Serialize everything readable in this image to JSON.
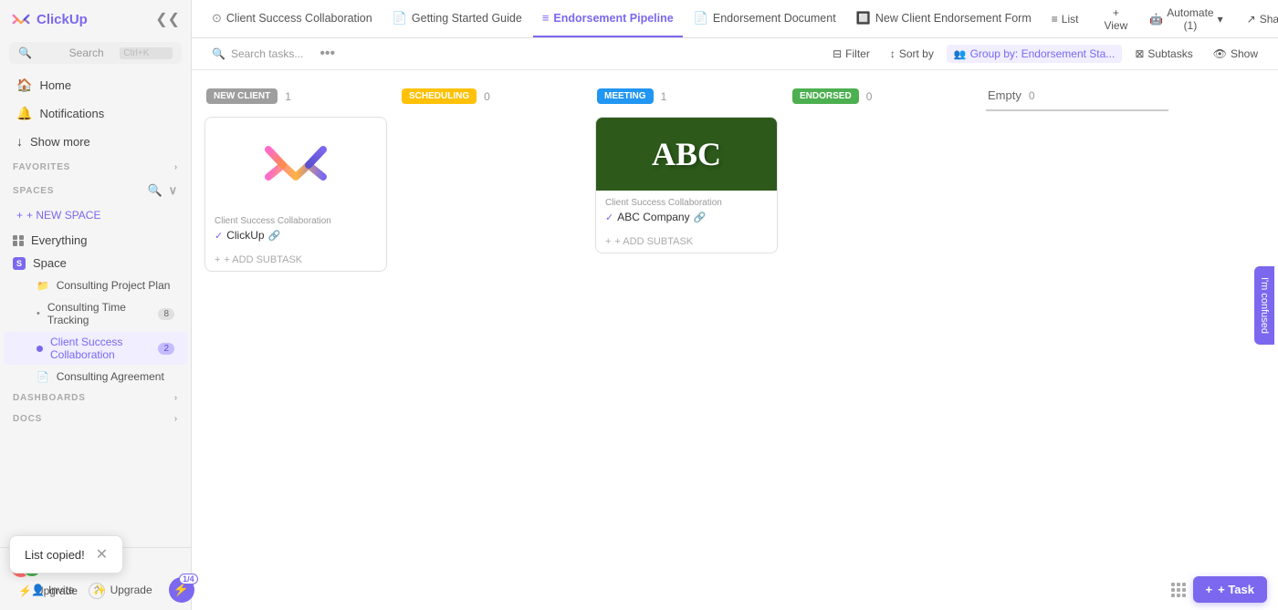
{
  "app": {
    "name": "ClickUp",
    "logo_text": "ClickUp"
  },
  "sidebar": {
    "search_placeholder": "Search",
    "search_shortcut": "Ctrl+K",
    "nav": [
      {
        "label": "Home",
        "icon": "🏠"
      },
      {
        "label": "Notifications",
        "icon": "🔔"
      },
      {
        "label": "Show more",
        "icon": "↓"
      }
    ],
    "sections": {
      "favorites": "FAVORITES",
      "spaces": "SPACES"
    },
    "new_space_label": "+ NEW SPACE",
    "everything_label": "Everything",
    "space_label": "Space",
    "space_badge": "S",
    "sub_items": [
      {
        "label": "Consulting Project Plan",
        "type": "folder",
        "count": null,
        "active": false
      },
      {
        "label": "Consulting Time Tracking",
        "type": "list",
        "count": "8",
        "active": false
      },
      {
        "label": "Client Success Collaboration",
        "type": "dot",
        "count": "2",
        "active": true
      },
      {
        "label": "Consulting Agreement",
        "type": "doc",
        "count": null,
        "active": false
      }
    ],
    "dashboards_label": "DASHBOARDS",
    "docs_label": "DOCS",
    "invite_label": "Invite",
    "upgrade_label": "Upgrade"
  },
  "top_nav": {
    "tabs": [
      {
        "label": "Client Success Collaboration",
        "icon": "⊙",
        "active": false
      },
      {
        "label": "Getting Started Guide",
        "icon": "📄",
        "active": false
      },
      {
        "label": "Endorsement Pipeline",
        "icon": "≡",
        "active": true
      },
      {
        "label": "Endorsement Document",
        "icon": "📄",
        "active": false
      },
      {
        "label": "New Client Endorsement Form",
        "icon": "🔲",
        "active": false
      }
    ],
    "list_label": "List",
    "view_label": "+ View",
    "automate_label": "Automate (1)",
    "share_label": "Share"
  },
  "toolbar": {
    "search_placeholder": "Search tasks...",
    "filter_label": "Filter",
    "sort_label": "Sort by",
    "group_by_label": "Group by: Endorsement Sta...",
    "subtasks_label": "Subtasks",
    "show_label": "Show"
  },
  "board": {
    "columns": [
      {
        "id": "new-client",
        "status": "NEW CLIENT",
        "status_class": "status-new-client",
        "count": 1,
        "cards": [
          {
            "id": "card-clickup",
            "project": "Client Success Collaboration",
            "title": "ClickUp",
            "image_type": "clickup",
            "has_link": true
          }
        ]
      },
      {
        "id": "scheduling",
        "status": "SCHEDULING",
        "status_class": "status-scheduling",
        "count": 0,
        "cards": []
      },
      {
        "id": "meeting",
        "status": "MEETING",
        "status_class": "status-meeting",
        "count": 1,
        "cards": [
          {
            "id": "card-abc",
            "project": "Client Success Collaboration",
            "title": "ABC Company",
            "image_type": "abc",
            "has_link": true
          }
        ]
      },
      {
        "id": "endorsed",
        "status": "ENDORSED",
        "status_class": "status-endorsed",
        "count": 0,
        "cards": []
      },
      {
        "id": "empty",
        "status": "Empty",
        "status_class": "",
        "count": 0,
        "cards": [],
        "is_empty": true
      }
    ]
  },
  "toast": {
    "message": "List copied!"
  },
  "bottom": {
    "bolt_count": "1/4",
    "add_task_label": "+ Task"
  },
  "feedback": {
    "label": "I'm confused"
  },
  "add_subtask_label": "+ ADD SUBTASK"
}
